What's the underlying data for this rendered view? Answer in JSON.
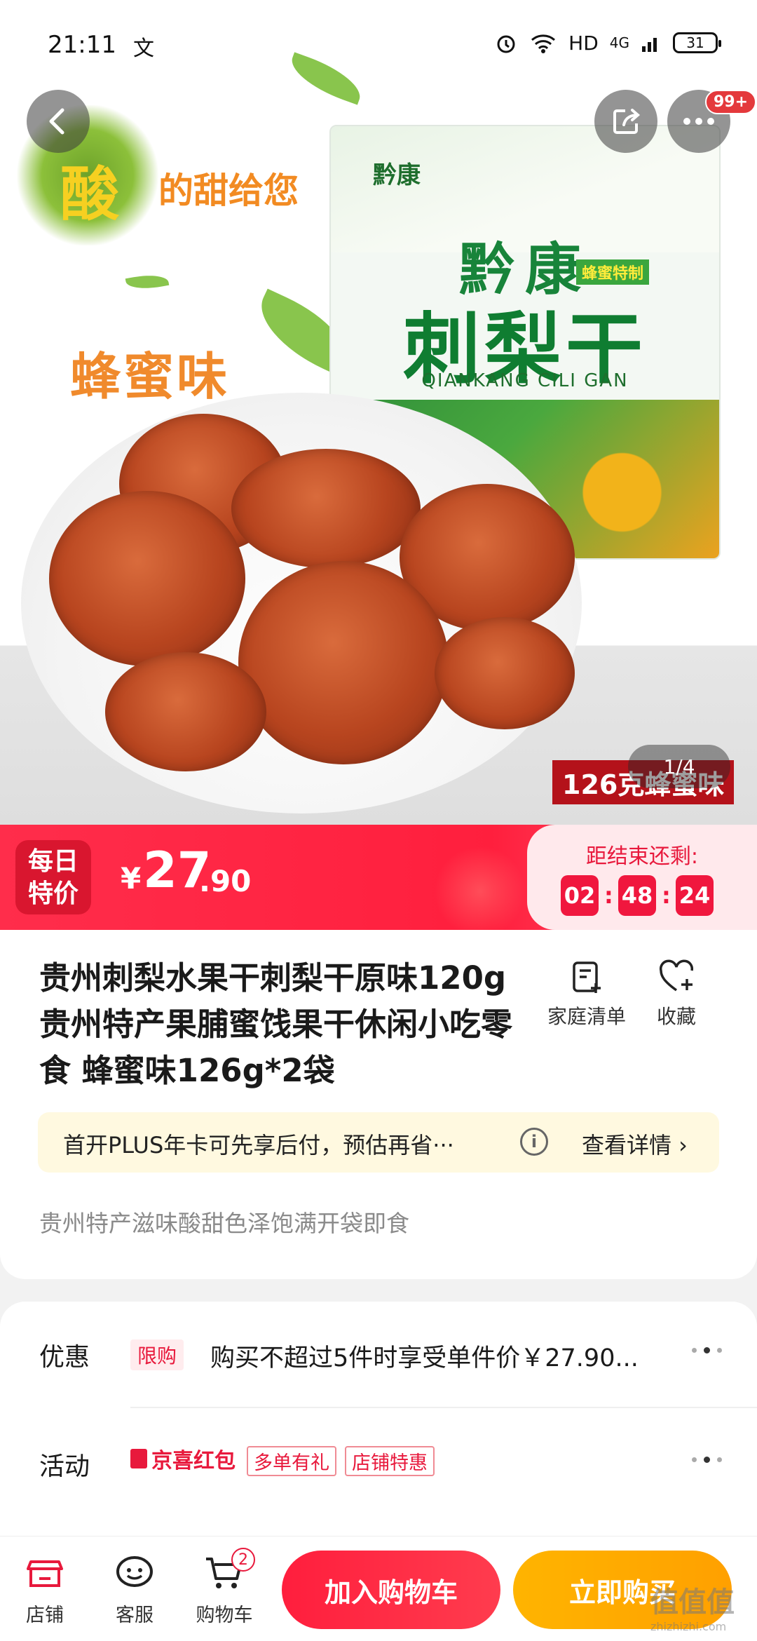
{
  "status_bar": {
    "time": "21:11",
    "extra": "文",
    "network": "HD",
    "signal": "4G",
    "battery": "31"
  },
  "hero": {
    "badge_count": "99+",
    "slogan_main": "酸",
    "slogan_rest": "的甜给您",
    "flavor": "蜂蜜味",
    "bag_logo": "黔康",
    "bag_brand": "黔康",
    "bag_tag": "蜂蜜特制",
    "bag_name": "刺梨干",
    "bag_pinyin": "QIANKANG CILI GAN",
    "size_label": "126克蜂蜜味",
    "pager": "1/4"
  },
  "price": {
    "promo_badge_line1": "每日",
    "promo_badge_line2": "特价",
    "currency": "¥",
    "integer": "27",
    "decimal": ".90",
    "countdown_label": "距结束还剩:",
    "hours": "02",
    "minutes": "48",
    "seconds": "24"
  },
  "product": {
    "title": "贵州刺梨水果干刺梨干原味120g贵州特产果脯蜜饯果干休闲小吃零食 蜂蜜味126g*2袋",
    "family_list": "家庭清单",
    "favorite": "收藏",
    "plus_text": "首开PLUS年卡可先享后付，预估再省···",
    "plus_link": "查看详情 ›",
    "subtitle": "贵州特产滋味酸甜色泽饱满开袋即食"
  },
  "promotions": {
    "discount_label": "优惠",
    "limit_tag": "限购",
    "discount_text": "购买不超过5件时享受单件价￥27.90...",
    "activity_label": "活动",
    "jx_tag": "京喜红包",
    "tag_multi": "多单有礼",
    "tag_store": "店铺特惠"
  },
  "bottom_bar": {
    "store": "店铺",
    "service": "客服",
    "cart": "购物车",
    "cart_count": "2",
    "add_to_cart": "加入购物车",
    "buy_now": "立即购买",
    "watermark": "值",
    "watermark_sub": "zhizhizhi.com"
  },
  "colors": {
    "accent_red": "#ff1f3d",
    "buy_orange": "#ffa000",
    "limit_red": "#e8193c"
  }
}
